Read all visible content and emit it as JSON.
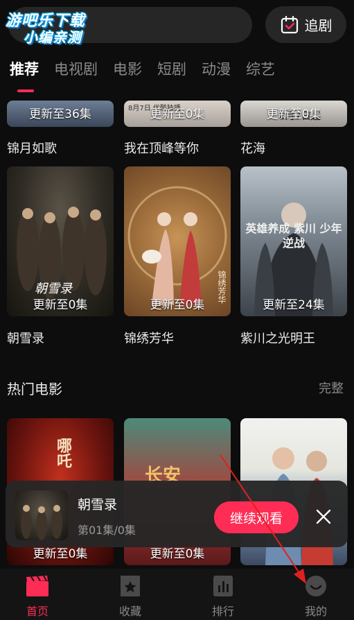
{
  "watermark": {
    "line1": "游吧乐下载",
    "line2": "小编亲测"
  },
  "header": {
    "follow_label": "追剧",
    "follow_icon": "calendar-check-icon"
  },
  "tabs": [
    {
      "label": "推荐",
      "active": true
    },
    {
      "label": "电视剧",
      "active": false
    },
    {
      "label": "电影",
      "active": false
    },
    {
      "label": "短剧",
      "active": false
    },
    {
      "label": "动漫",
      "active": false
    },
    {
      "label": "综艺",
      "active": false
    }
  ],
  "row1": [
    {
      "title": "锦月如歌",
      "badge": "更新至36集"
    },
    {
      "title": "我在顶峰等你",
      "badge": "更新至0集",
      "poster_text": "8月7日 优酷独播"
    },
    {
      "title": "花海",
      "badge": "更新至0集",
      "poster_text": "8月7日起"
    }
  ],
  "row2": [
    {
      "title": "朝雪录",
      "badge": "更新至0集",
      "poster_text": "朝雪录"
    },
    {
      "title": "锦绣芳华",
      "badge": "更新至0集",
      "poster_text": "锦绣芳华"
    },
    {
      "title": "紫川之光明王",
      "badge": "更新至24集",
      "poster_text": "英雄养成 紫川 少年逆战"
    }
  ],
  "section": {
    "title": "热门电影",
    "more": "完整"
  },
  "movies": [
    {
      "badge": "更新至0集",
      "poster_text": "哪吒"
    },
    {
      "badge": "更新至0集",
      "poster_text": "长安"
    },
    {
      "badge": "",
      "poster_text": ""
    }
  ],
  "continue_watching": {
    "title": "朝雪录",
    "subtitle": "第01集/0集",
    "button": "继续观看"
  },
  "bottom_nav": [
    {
      "label": "首页",
      "icon": "clapperboard-icon",
      "active": true
    },
    {
      "label": "收藏",
      "icon": "star-box-icon",
      "active": false
    },
    {
      "label": "排行",
      "icon": "bar-chart-icon",
      "active": false
    },
    {
      "label": "我的",
      "icon": "smile-face-icon",
      "active": false
    }
  ],
  "colors": {
    "accent": "#ff2d55",
    "background": "#0d0d0d",
    "annotation_arrow": "#e0201f"
  }
}
